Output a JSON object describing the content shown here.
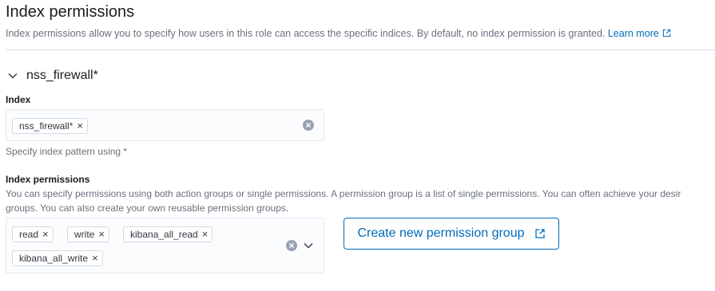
{
  "section": {
    "title": "Index permissions",
    "description": "Index permissions allow you to specify how users in this role can access the specific indices. By default, no index permission is granted. ",
    "learn_more": "Learn more"
  },
  "accordion": {
    "title": "nss_firewall*"
  },
  "index_field": {
    "label": "Index",
    "pills": [
      "nss_firewall*"
    ],
    "help": "Specify index pattern using *"
  },
  "permissions_field": {
    "label": "Index permissions",
    "help_line1": "You can specify permissions using both action groups or single permissions. A permission group is a list of single permissions. You can often achieve your desir",
    "help_line2": "groups. You can also create your own reusable permission groups.",
    "pills": [
      "read",
      "write",
      "kibana_all_read",
      "kibana_all_write"
    ]
  },
  "create_button": {
    "label": "Create new permission group"
  },
  "icons": {
    "remove_pill": "×",
    "chevron": "chevron-down-icon",
    "external": "external-link-icon",
    "clear": "clear-icon"
  },
  "colors": {
    "link": "#006bb8",
    "title": "#1a1c21",
    "subdued": "#69707d"
  }
}
